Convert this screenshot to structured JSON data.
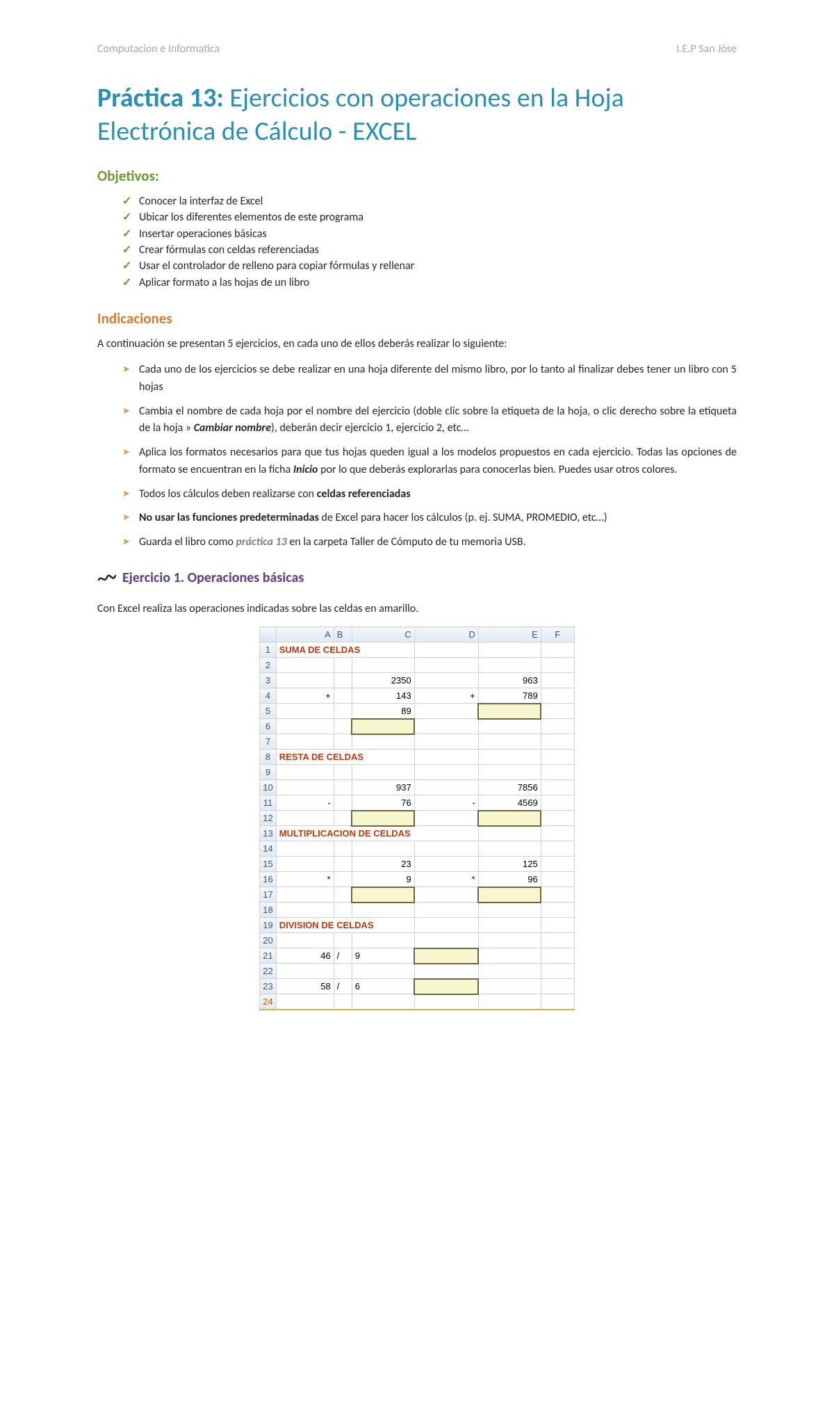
{
  "header": {
    "left": "Computacion e Informatica",
    "right": "I.E.P  San Jóse"
  },
  "title": {
    "prefix": "Práctica 13:",
    "rest": " Ejercicios con operaciones en la Hoja Electrónica de Cálculo - EXCEL"
  },
  "objectives": {
    "heading": "Objetivos:",
    "items": [
      "Conocer la interfaz de Excel",
      "Ubicar los diferentes elementos de este programa",
      "Insertar operaciones básicas",
      "Crear fórmulas con celdas referenciadas",
      "Usar el controlador de relleno para copiar fórmulas y rellenar",
      "Aplicar formato a las hojas de un libro"
    ]
  },
  "indications": {
    "heading": "Indicaciones",
    "intro": "A continuación se presentan 5 ejercicios, en cada uno de ellos deberás realizar lo siguiente:",
    "items": {
      "i1": "Cada uno de los ejercicios se debe realizar en una hoja diferente del mismo libro, por lo tanto al finalizar debes tener un libro con 5 hojas",
      "i2a": "Cambia el nombre de cada hoja por el nombre del ejercicio (doble clic sobre la etiqueta de la hoja, o clic derecho sobre la etiqueta de la hoja » ",
      "i2b": "Cambiar nombre",
      "i2c": "), deberán decir ejercicio 1, ejercicio 2, etc…",
      "i3a": "Aplica los formatos necesarios para que tus hojas queden igual a los modelos propuestos en cada ejercicio. Todas las opciones de formato se encuentran en la ficha ",
      "i3b": "Inicio",
      "i3c": " por lo que deberás explorarlas para conocerlas bien. Puedes usar otros colores.",
      "i4a": "Todos los cálculos deben realizarse con ",
      "i4b": "celdas referenciadas",
      "i5a": "No usar las funciones predeterminadas",
      "i5b": " de Excel para hacer los cálculos (p. ej. SUMA, PROMEDIO, etc…)",
      "i6a": "Guarda el libro como ",
      "i6b": "práctica 13",
      "i6c": " en la carpeta Taller de Cómputo de tu memoria USB."
    }
  },
  "exercise": {
    "heading": "Ejercicio 1. Operaciones básicas",
    "intro": "Con Excel realiza las operaciones indicadas sobre las celdas en amarillo."
  },
  "excel": {
    "cols": [
      "A",
      "B",
      "C",
      "D",
      "E",
      "F"
    ],
    "rowCount": 24,
    "sections": {
      "r1": "SUMA DE CELDAS",
      "r8": "RESTA DE CELDAS",
      "r13": "MULTIPLICACION DE CELDAS",
      "r19": "DIVISION DE CELDAS"
    },
    "cells": {
      "r3": {
        "C": "2350",
        "E": "963"
      },
      "r4": {
        "A": "+",
        "C": "143",
        "D": "+",
        "E": "789"
      },
      "r5": {
        "C": "89"
      },
      "r10": {
        "C": "937",
        "E": "7856"
      },
      "r11": {
        "A": "-",
        "C": "76",
        "D": "-",
        "E": "4569"
      },
      "r15": {
        "C": "23",
        "E": "125"
      },
      "r16": {
        "A": "*",
        "C": "9",
        "D": "*",
        "E": "96"
      },
      "r21": {
        "A": "46",
        "B": "/",
        "C": "9"
      },
      "r23": {
        "A": "58",
        "B": "/",
        "C": "6"
      }
    }
  }
}
